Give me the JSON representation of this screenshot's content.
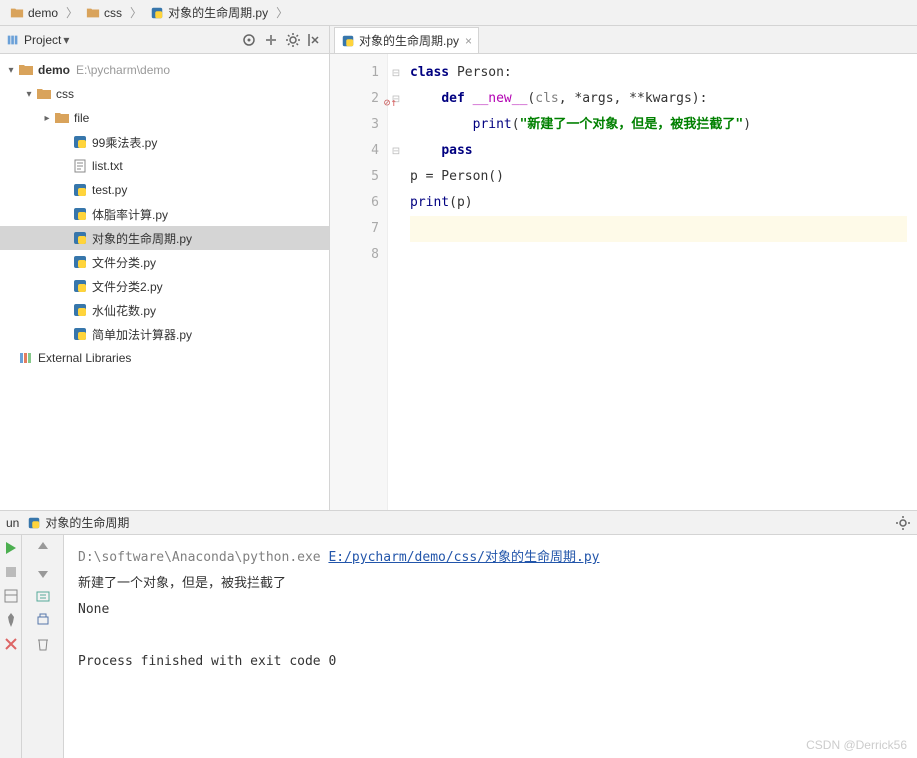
{
  "breadcrumb": {
    "items": [
      {
        "label": "demo",
        "icon": "folder"
      },
      {
        "label": "css",
        "icon": "folder"
      },
      {
        "label": "对象的生命周期.py",
        "icon": "python"
      }
    ]
  },
  "project": {
    "title": "Project",
    "tree": [
      {
        "indent": 0,
        "toggle": "▾",
        "icon": "folder",
        "label": "demo",
        "path": "E:\\pycharm\\demo",
        "bold": true
      },
      {
        "indent": 1,
        "toggle": "▾",
        "icon": "folder",
        "label": "css"
      },
      {
        "indent": 2,
        "toggle": "▸",
        "icon": "folder",
        "label": "file"
      },
      {
        "indent": 3,
        "toggle": "",
        "icon": "python",
        "label": "99乘法表.py"
      },
      {
        "indent": 3,
        "toggle": "",
        "icon": "text",
        "label": "list.txt"
      },
      {
        "indent": 3,
        "toggle": "",
        "icon": "python",
        "label": "test.py"
      },
      {
        "indent": 3,
        "toggle": "",
        "icon": "python",
        "label": "体脂率计算.py"
      },
      {
        "indent": 3,
        "toggle": "",
        "icon": "python",
        "label": "对象的生命周期.py",
        "selected": true
      },
      {
        "indent": 3,
        "toggle": "",
        "icon": "python",
        "label": "文件分类.py"
      },
      {
        "indent": 3,
        "toggle": "",
        "icon": "python",
        "label": "文件分类2.py"
      },
      {
        "indent": 3,
        "toggle": "",
        "icon": "python",
        "label": "水仙花数.py"
      },
      {
        "indent": 3,
        "toggle": "",
        "icon": "python",
        "label": "简单加法计算器.py"
      },
      {
        "indent": 0,
        "toggle": "",
        "icon": "lib",
        "label": "External Libraries"
      }
    ]
  },
  "editor": {
    "tab": {
      "label": "对象的生命周期.py"
    },
    "lines": [
      "1",
      "2",
      "3",
      "4",
      "5",
      "6",
      "7",
      "8"
    ],
    "code": [
      {
        "tokens": [
          {
            "cls": "kw",
            "t": "class "
          },
          {
            "cls": "",
            "t": "Person:"
          }
        ]
      },
      {
        "tokens": [
          {
            "cls": "",
            "t": "    "
          },
          {
            "cls": "kw",
            "t": "def "
          },
          {
            "cls": "fn",
            "t": "__new__"
          },
          {
            "cls": "",
            "t": "("
          },
          {
            "cls": "param",
            "t": "cls"
          },
          {
            "cls": "",
            "t": ", *args, **kwargs):"
          }
        ]
      },
      {
        "tokens": [
          {
            "cls": "",
            "t": "        "
          },
          {
            "cls": "bi",
            "t": "print"
          },
          {
            "cls": "",
            "t": "("
          },
          {
            "cls": "str",
            "t": "\"新建了一个对象，但是，被我拦截了\""
          },
          {
            "cls": "",
            "t": ")"
          }
        ]
      },
      {
        "tokens": [
          {
            "cls": "",
            "t": "    "
          },
          {
            "cls": "kw",
            "t": "pass"
          }
        ]
      },
      {
        "tokens": [
          {
            "cls": "",
            "t": "p = Person()"
          }
        ]
      },
      {
        "tokens": [
          {
            "cls": "bi",
            "t": "print"
          },
          {
            "cls": "",
            "t": "(p)"
          }
        ]
      },
      {
        "tokens": [
          {
            "cls": "",
            "t": ""
          }
        ],
        "hl": true
      },
      {
        "tokens": [
          {
            "cls": "",
            "t": ""
          }
        ]
      }
    ],
    "markers": {
      "line2": "⊘↑"
    }
  },
  "run": {
    "header_prefix": "un",
    "config_label": "对象的生命周期",
    "console": {
      "cmd_path": "D:\\software\\Anaconda\\python.exe ",
      "cmd_file": "E:/pycharm/demo/css/对象的生命周期.py",
      "out1": "新建了一个对象，但是，被我拦截了",
      "out2": "None",
      "exit": "Process finished with exit code 0"
    }
  },
  "watermark": "CSDN @Derrick56"
}
